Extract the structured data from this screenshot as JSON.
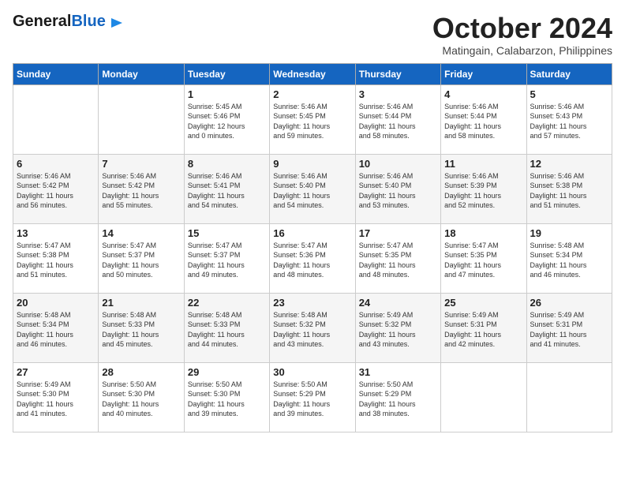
{
  "header": {
    "logo_general": "General",
    "logo_blue": "Blue",
    "month_title": "October 2024",
    "location": "Matingain, Calabarzon, Philippines"
  },
  "weekdays": [
    "Sunday",
    "Monday",
    "Tuesday",
    "Wednesday",
    "Thursday",
    "Friday",
    "Saturday"
  ],
  "weeks": [
    [
      {
        "day": "",
        "info": ""
      },
      {
        "day": "",
        "info": ""
      },
      {
        "day": "1",
        "info": "Sunrise: 5:45 AM\nSunset: 5:46 PM\nDaylight: 12 hours\nand 0 minutes."
      },
      {
        "day": "2",
        "info": "Sunrise: 5:46 AM\nSunset: 5:45 PM\nDaylight: 11 hours\nand 59 minutes."
      },
      {
        "day": "3",
        "info": "Sunrise: 5:46 AM\nSunset: 5:44 PM\nDaylight: 11 hours\nand 58 minutes."
      },
      {
        "day": "4",
        "info": "Sunrise: 5:46 AM\nSunset: 5:44 PM\nDaylight: 11 hours\nand 58 minutes."
      },
      {
        "day": "5",
        "info": "Sunrise: 5:46 AM\nSunset: 5:43 PM\nDaylight: 11 hours\nand 57 minutes."
      }
    ],
    [
      {
        "day": "6",
        "info": "Sunrise: 5:46 AM\nSunset: 5:42 PM\nDaylight: 11 hours\nand 56 minutes."
      },
      {
        "day": "7",
        "info": "Sunrise: 5:46 AM\nSunset: 5:42 PM\nDaylight: 11 hours\nand 55 minutes."
      },
      {
        "day": "8",
        "info": "Sunrise: 5:46 AM\nSunset: 5:41 PM\nDaylight: 11 hours\nand 54 minutes."
      },
      {
        "day": "9",
        "info": "Sunrise: 5:46 AM\nSunset: 5:40 PM\nDaylight: 11 hours\nand 54 minutes."
      },
      {
        "day": "10",
        "info": "Sunrise: 5:46 AM\nSunset: 5:40 PM\nDaylight: 11 hours\nand 53 minutes."
      },
      {
        "day": "11",
        "info": "Sunrise: 5:46 AM\nSunset: 5:39 PM\nDaylight: 11 hours\nand 52 minutes."
      },
      {
        "day": "12",
        "info": "Sunrise: 5:46 AM\nSunset: 5:38 PM\nDaylight: 11 hours\nand 51 minutes."
      }
    ],
    [
      {
        "day": "13",
        "info": "Sunrise: 5:47 AM\nSunset: 5:38 PM\nDaylight: 11 hours\nand 51 minutes."
      },
      {
        "day": "14",
        "info": "Sunrise: 5:47 AM\nSunset: 5:37 PM\nDaylight: 11 hours\nand 50 minutes."
      },
      {
        "day": "15",
        "info": "Sunrise: 5:47 AM\nSunset: 5:37 PM\nDaylight: 11 hours\nand 49 minutes."
      },
      {
        "day": "16",
        "info": "Sunrise: 5:47 AM\nSunset: 5:36 PM\nDaylight: 11 hours\nand 48 minutes."
      },
      {
        "day": "17",
        "info": "Sunrise: 5:47 AM\nSunset: 5:35 PM\nDaylight: 11 hours\nand 48 minutes."
      },
      {
        "day": "18",
        "info": "Sunrise: 5:47 AM\nSunset: 5:35 PM\nDaylight: 11 hours\nand 47 minutes."
      },
      {
        "day": "19",
        "info": "Sunrise: 5:48 AM\nSunset: 5:34 PM\nDaylight: 11 hours\nand 46 minutes."
      }
    ],
    [
      {
        "day": "20",
        "info": "Sunrise: 5:48 AM\nSunset: 5:34 PM\nDaylight: 11 hours\nand 46 minutes."
      },
      {
        "day": "21",
        "info": "Sunrise: 5:48 AM\nSunset: 5:33 PM\nDaylight: 11 hours\nand 45 minutes."
      },
      {
        "day": "22",
        "info": "Sunrise: 5:48 AM\nSunset: 5:33 PM\nDaylight: 11 hours\nand 44 minutes."
      },
      {
        "day": "23",
        "info": "Sunrise: 5:48 AM\nSunset: 5:32 PM\nDaylight: 11 hours\nand 43 minutes."
      },
      {
        "day": "24",
        "info": "Sunrise: 5:49 AM\nSunset: 5:32 PM\nDaylight: 11 hours\nand 43 minutes."
      },
      {
        "day": "25",
        "info": "Sunrise: 5:49 AM\nSunset: 5:31 PM\nDaylight: 11 hours\nand 42 minutes."
      },
      {
        "day": "26",
        "info": "Sunrise: 5:49 AM\nSunset: 5:31 PM\nDaylight: 11 hours\nand 41 minutes."
      }
    ],
    [
      {
        "day": "27",
        "info": "Sunrise: 5:49 AM\nSunset: 5:30 PM\nDaylight: 11 hours\nand 41 minutes."
      },
      {
        "day": "28",
        "info": "Sunrise: 5:50 AM\nSunset: 5:30 PM\nDaylight: 11 hours\nand 40 minutes."
      },
      {
        "day": "29",
        "info": "Sunrise: 5:50 AM\nSunset: 5:30 PM\nDaylight: 11 hours\nand 39 minutes."
      },
      {
        "day": "30",
        "info": "Sunrise: 5:50 AM\nSunset: 5:29 PM\nDaylight: 11 hours\nand 39 minutes."
      },
      {
        "day": "31",
        "info": "Sunrise: 5:50 AM\nSunset: 5:29 PM\nDaylight: 11 hours\nand 38 minutes."
      },
      {
        "day": "",
        "info": ""
      },
      {
        "day": "",
        "info": ""
      }
    ]
  ]
}
